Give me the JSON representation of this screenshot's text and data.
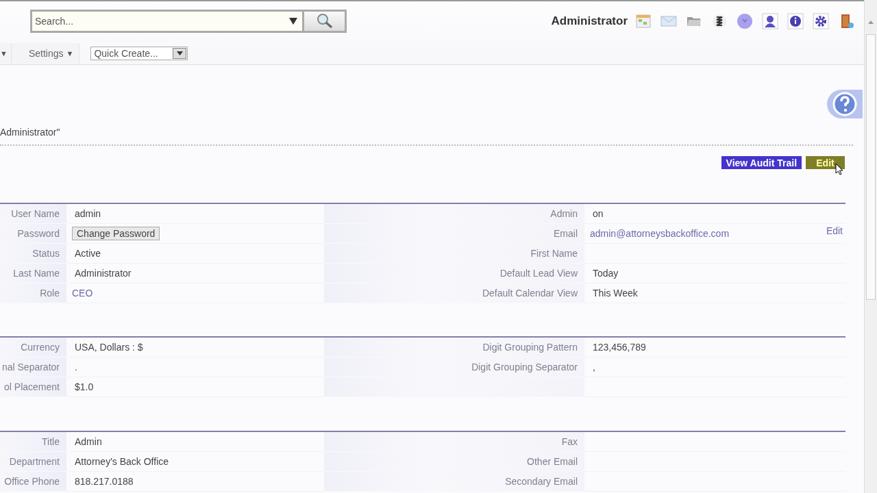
{
  "search": {
    "placeholder": "Search..."
  },
  "nav": {
    "menus": [
      {
        "caret": "▼"
      },
      {
        "label": "Settings",
        "caret": "▼"
      }
    ],
    "quick_create": {
      "value": "Quick Create..."
    }
  },
  "user": {
    "name": "Administrator"
  },
  "record": {
    "title": "Administrator\""
  },
  "actions": [
    {
      "label": "View Audit Trail",
      "kind": "primary"
    },
    {
      "label": "Edit",
      "kind": "highlighted"
    }
  ],
  "sections": [
    {
      "rows": [
        {
          "left": {
            "label": "User Name",
            "value": "admin",
            "kind": "text"
          },
          "right": {
            "label": "Admin",
            "value": "on",
            "kind": "text"
          }
        },
        {
          "left": {
            "label": "Password",
            "value": "Change Password",
            "kind": "button"
          },
          "right": {
            "label": "Email",
            "value": "admin@attorneysbackoffice.com",
            "kind": "link"
          },
          "edit_link": "Edit"
        },
        {
          "left": {
            "label": "Status",
            "value": "Active",
            "kind": "text"
          },
          "right": {
            "label": "First Name"
          }
        },
        {
          "left": {
            "label": "Last Name",
            "value": "Administrator",
            "kind": "text"
          },
          "right": {
            "label": "Default Lead View",
            "value": "Today",
            "kind": "text"
          }
        },
        {
          "left": {
            "label": "Role",
            "value": "CEO",
            "kind": "link"
          },
          "right": {
            "label": "Default Calendar View",
            "value": "This Week",
            "kind": "text"
          }
        }
      ]
    },
    {
      "rows": [
        {
          "left": {
            "label": "Currency",
            "value": "USA, Dollars : $",
            "kind": "text"
          },
          "right": {
            "label": "Digit Grouping Pattern",
            "value": "123,456,789",
            "kind": "text"
          }
        },
        {
          "left": {
            "label": "nal Separator",
            "value": ".",
            "kind": "text"
          },
          "right": {
            "label": "Digit Grouping Separator",
            "value": ",",
            "kind": "text"
          }
        },
        {
          "left": {
            "label": "ol Placement",
            "value": "$1.0",
            "kind": "text"
          },
          "right": {}
        }
      ]
    },
    {
      "rows": [
        {
          "left": {
            "label": "Title",
            "value": "Admin",
            "kind": "text"
          },
          "right": {
            "label": "Fax"
          }
        },
        {
          "left": {
            "label": "Department",
            "value": "Attorney's Back Office",
            "kind": "text"
          },
          "right": {
            "label": "Other Email"
          }
        },
        {
          "left": {
            "label": "Office Phone",
            "value": "818.217.0188",
            "kind": "text"
          },
          "right": {
            "label": "Secondary Email"
          }
        }
      ]
    }
  ]
}
